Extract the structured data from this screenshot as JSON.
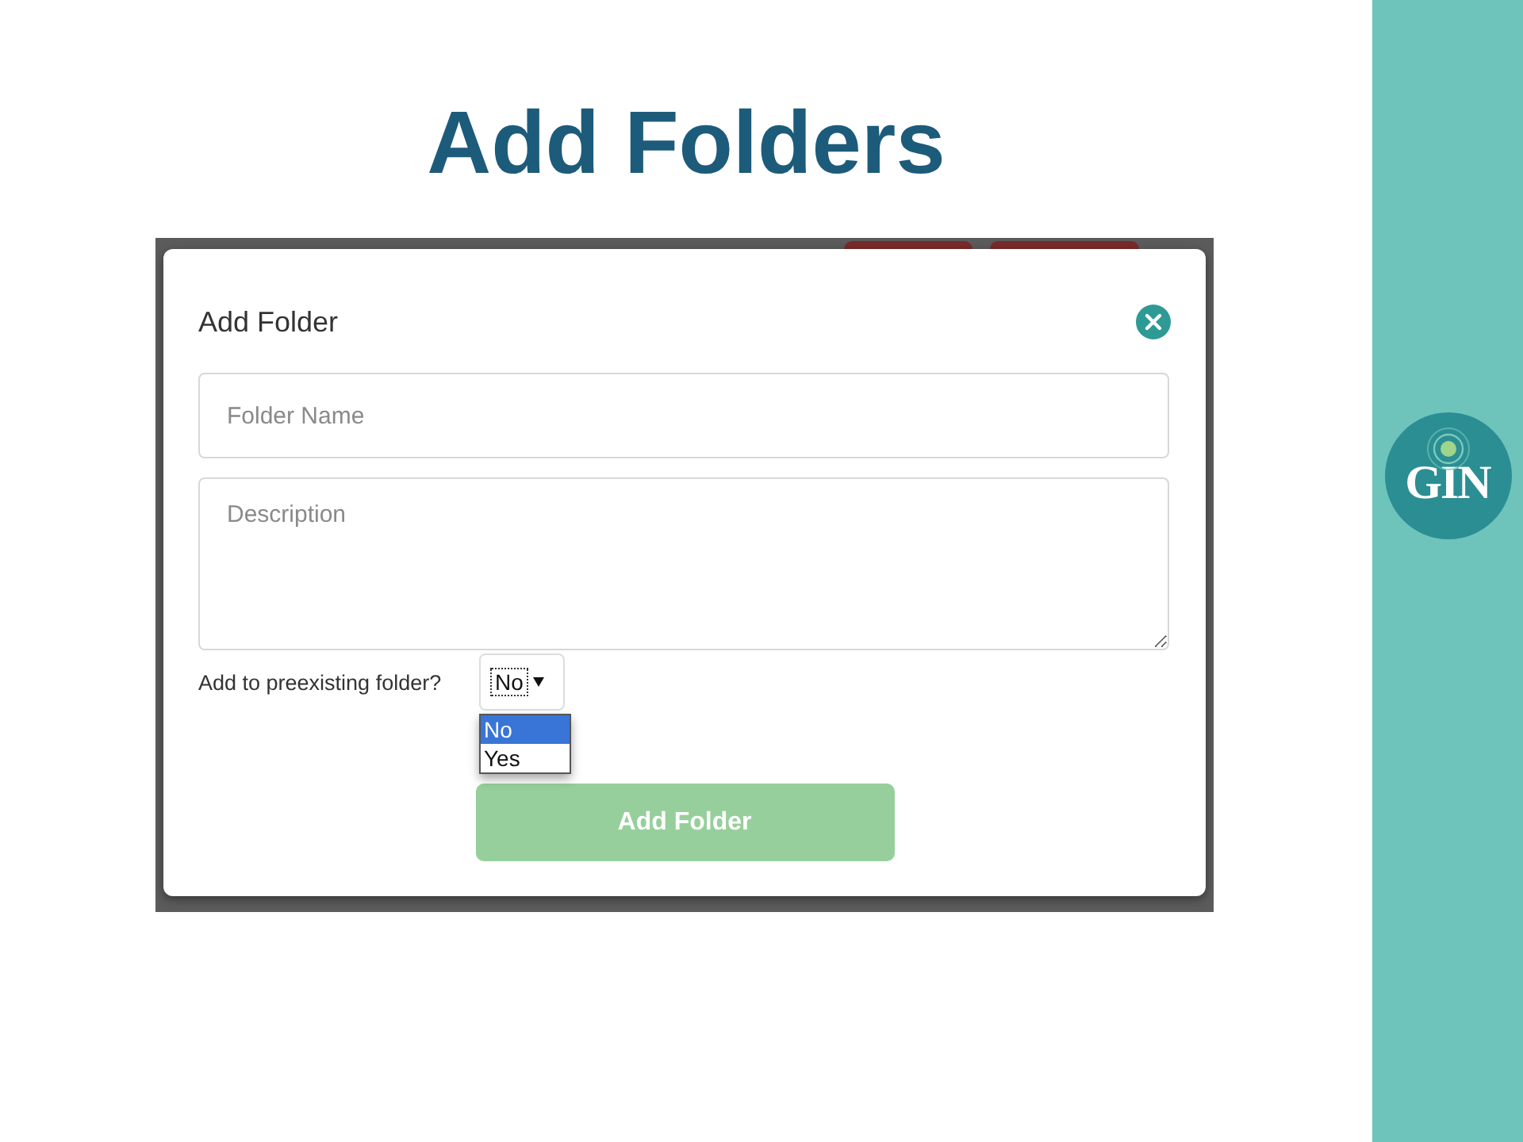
{
  "slide": {
    "title": "Add Folders"
  },
  "dialog": {
    "title": "Add Folder",
    "fields": [
      {
        "kind": "input",
        "placeholder": "Folder Name"
      },
      {
        "kind": "textarea",
        "placeholder": "Description"
      }
    ],
    "select": {
      "label": "Add to preexisting folder?",
      "value": "No",
      "expanded": true,
      "options": [
        {
          "label": "No",
          "selected": true
        },
        {
          "label": "Yes",
          "selected": false
        }
      ]
    },
    "submit": "Add Folder"
  },
  "logo": {
    "text": "GIN"
  }
}
